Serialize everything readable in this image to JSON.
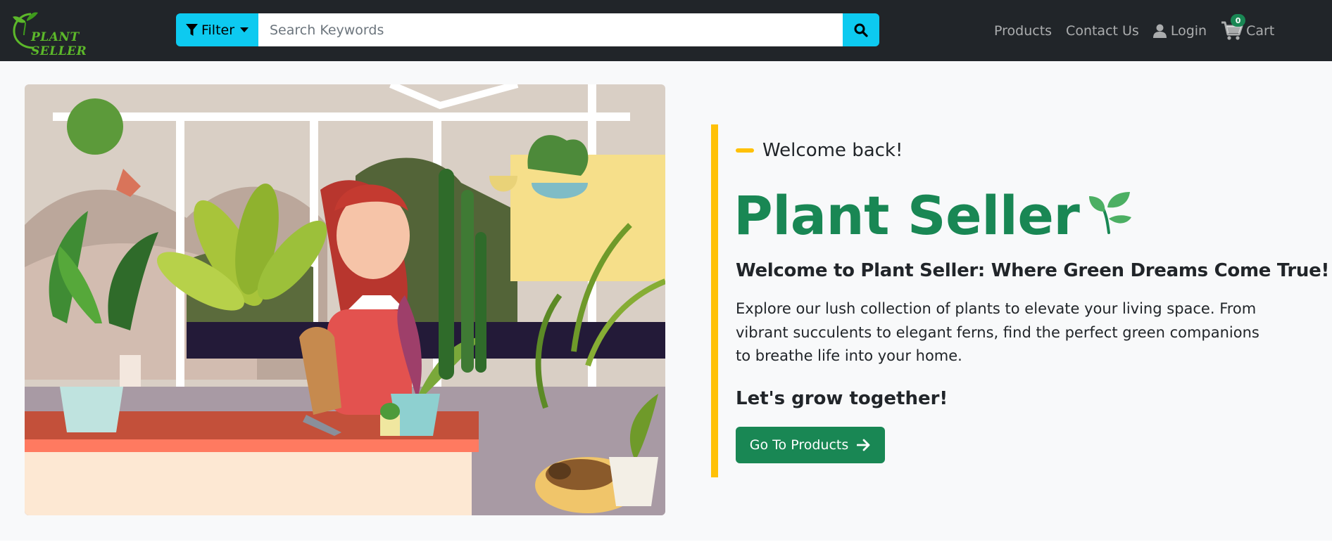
{
  "header": {
    "logo_text": "PLANT SELLER",
    "filter_label": "Filter",
    "search_placeholder": "Search Keywords",
    "nav": {
      "products": "Products",
      "contact": "Contact Us",
      "login": "Login",
      "cart": "Cart",
      "cart_count": "0"
    }
  },
  "hero": {
    "welcome": "Welcome back!",
    "title": "Plant Seller",
    "subtitle": "Welcome to Plant Seller: Where Green Dreams Come True!",
    "description": "Explore our lush collection of plants to elevate your living space. From vibrant succulents to elegant ferns, find the perfect green companions to breathe life into your home.",
    "tagline": "Let's grow together!",
    "cta_label": "Go To Products"
  },
  "icons": {
    "filter": "funnel-icon",
    "search": "search-icon",
    "login": "user-icon",
    "cart": "cart-icon",
    "title": "sprout-icon",
    "cta": "arrow-right-icon"
  },
  "colors": {
    "navbar": "#212529",
    "accent_cyan": "#0dcaf0",
    "brand_green": "#198754",
    "accent_yellow": "#ffc107",
    "background": "#f8f9fa"
  }
}
